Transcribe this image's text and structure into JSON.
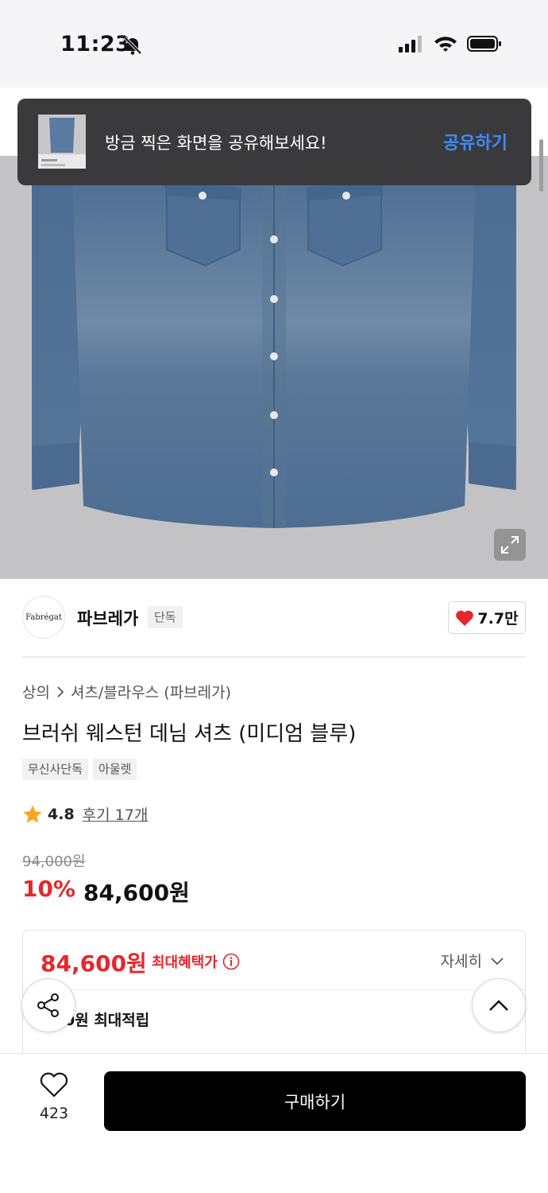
{
  "status_bar": {
    "time": "11:23"
  },
  "toast": {
    "message": "방금 찍은 화면을 공유해보세요!",
    "action": "공유하기"
  },
  "brand": {
    "logo_text": "Fabrégat",
    "name": "파브레가",
    "badge": "단독",
    "likes": "7.7만"
  },
  "breadcrumb": {
    "category": "상의",
    "subcategory": "셔츠/블라우스 (파브레가)"
  },
  "product": {
    "title": "브러쉬 웨스턴 데님 셔츠 (미디엄 블루)",
    "tags": [
      "무신사단독",
      "아울렛"
    ],
    "rating": "4.8",
    "reviews": "후기 17개",
    "original_price": "94,000원",
    "discount": "10%",
    "price": "84,600원"
  },
  "benefit": {
    "price": "84,600원",
    "label": "최대혜택가",
    "detail": "자세히",
    "points": "0원 최대적립"
  },
  "bottom_bar": {
    "wishlist_count": "423",
    "buy_label": "구매하기"
  },
  "colors": {
    "accent_red": "#e8262b",
    "toast_link": "#3d8bff",
    "denim": "#4f6f94"
  }
}
